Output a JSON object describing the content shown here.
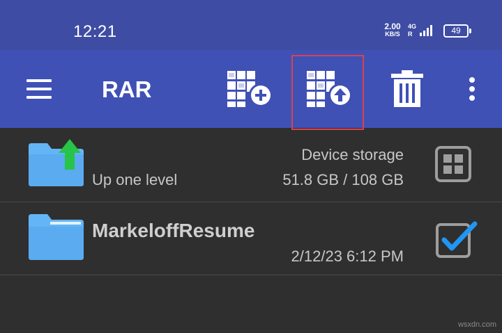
{
  "status_bar": {
    "time": "12:21",
    "net_speed_value": "2.00",
    "net_speed_unit": "KB/S",
    "network_type": "4G",
    "roaming": "R",
    "battery_level": "49"
  },
  "app_bar": {
    "title": "RAR",
    "actions": [
      {
        "name": "add-to-archive",
        "icon": "archive-add-icon"
      },
      {
        "name": "extract-from-archive",
        "icon": "archive-extract-icon"
      },
      {
        "name": "delete",
        "icon": "trash-icon"
      },
      {
        "name": "more-options",
        "icon": "more-vert-icon"
      }
    ]
  },
  "file_list": {
    "up_row": {
      "label": "Up one level",
      "storage_name": "Device storage",
      "storage_size": "51.8 GB / 108 GB"
    },
    "items": [
      {
        "name": "MarkeloffResume",
        "date": "2/12/23 6:12 PM",
        "checked": true
      }
    ]
  },
  "watermark": "wsxdn.com",
  "colors": {
    "status_bar": "#3e4ca3",
    "app_bar": "#3f51b5",
    "background": "#2f2f2f",
    "folder": "#64b5f6",
    "up_arrow": "#27c449",
    "checkmark": "#2196f3",
    "highlight": "#d9424f"
  }
}
